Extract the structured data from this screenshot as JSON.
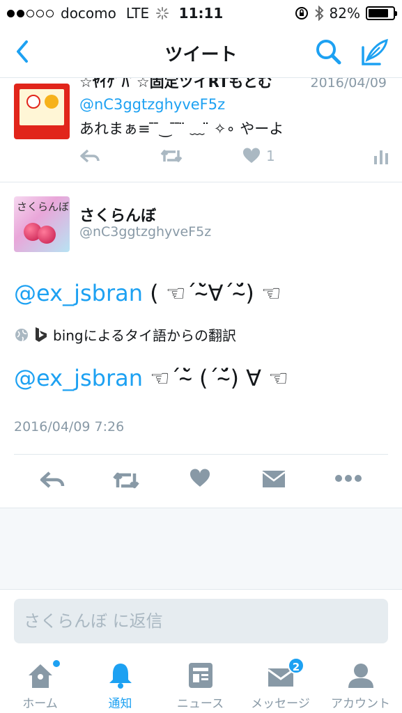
{
  "status_bar": {
    "carrier": "docomo",
    "network": "LTE",
    "time": "11:11",
    "battery": "82%",
    "battery_level": 0.82
  },
  "nav": {
    "title": "ツイート"
  },
  "prev_tweet": {
    "name": "☆ﾔｲｹﾞﾊﾞ☆固定ツイRTもとむ",
    "date": "2016/04/09",
    "handle": "@nC3ggtzghyveF5z",
    "text": "あれまぁ≡ ̄ ̄‿ ̄ ̄ ̈ ﹏ ̈ ✧∘ やーよ",
    "like_count": "1"
  },
  "tweet": {
    "name": "さくらんぼ",
    "handle": "@nC3ggtzghyveF5z",
    "avatar_text": "さくらんぼ",
    "mention": "@ex_jsbran",
    "body1_rest": " ( ☜´˘̴̀∀´˘̴́) ☜",
    "translation_note": "bingによるタイ語からの翻訳",
    "body2_rest": "  ☜´˘̴̀ (´˘̴́) ∀  ☜",
    "timestamp": "2016/04/09 7:26"
  },
  "reply": {
    "placeholder": "さくらんぼ に返信"
  },
  "tabs": [
    {
      "label": "ホーム",
      "icon": "home-icon"
    },
    {
      "label": "通知",
      "icon": "bell-icon"
    },
    {
      "label": "ニュース",
      "icon": "news-icon"
    },
    {
      "label": "メッセージ",
      "icon": "message-icon",
      "badge": "2"
    },
    {
      "label": "アカウント",
      "icon": "account-icon"
    }
  ],
  "colors": {
    "accent": "#1da1f2",
    "muted": "#8899a6",
    "icon_gray": "#aab8c2"
  }
}
